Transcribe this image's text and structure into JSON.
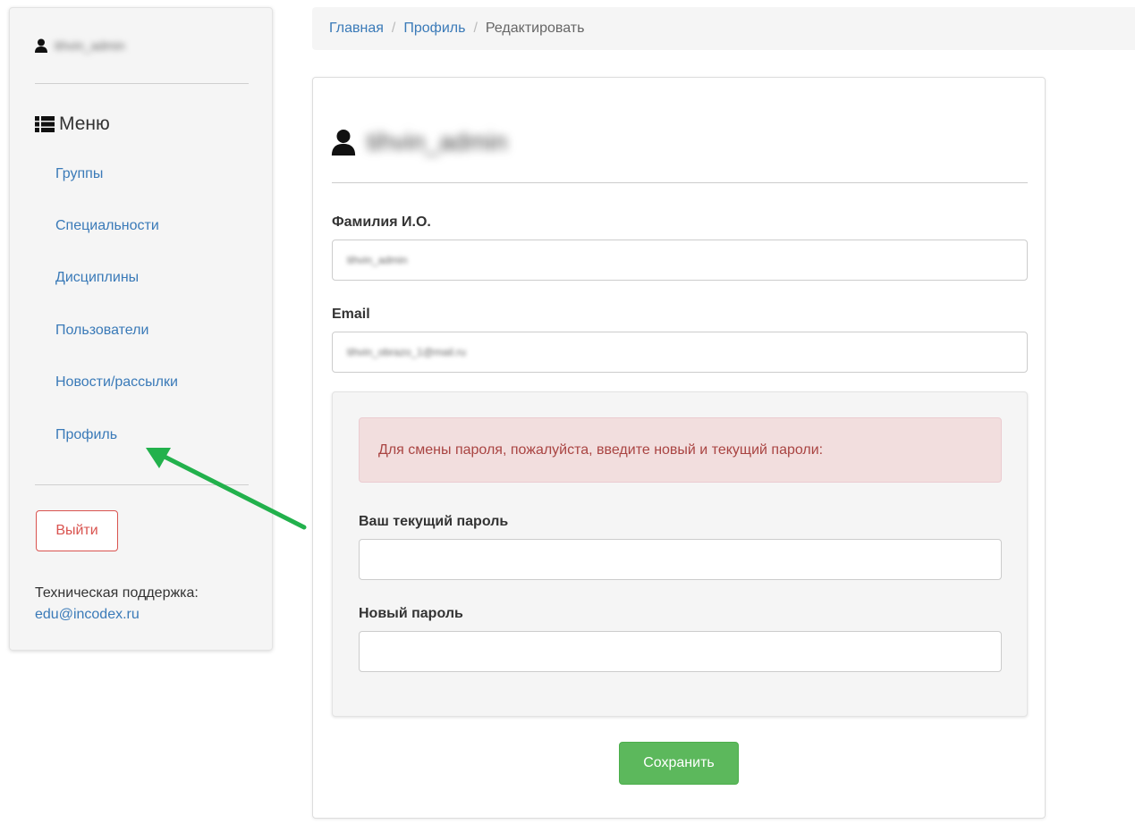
{
  "sidebar": {
    "user_name": "tihvin_admin",
    "menu_title": "Меню",
    "items": [
      {
        "label": "Группы"
      },
      {
        "label": "Специальности"
      },
      {
        "label": "Дисциплины"
      },
      {
        "label": "Пользователи"
      },
      {
        "label": "Новости/рассылки"
      },
      {
        "label": "Профиль"
      }
    ],
    "logout_label": "Выйти",
    "support_label": "Техническая поддержка:",
    "support_email": "edu@incodex.ru"
  },
  "breadcrumb": {
    "items": [
      "Главная",
      "Профиль"
    ],
    "separator": "/",
    "active": "Редактировать"
  },
  "profile": {
    "username": "tihvin_admin",
    "fio_label": "Фамилия И.О.",
    "fio_value": "tihvin_admin",
    "email_label": "Email",
    "email_value": "tihvin_obrazo_1@mail.ru",
    "password_alert": "Для смены пароля, пожалуйста, введите новый и текущий пароли:",
    "current_password_label": "Ваш текущий пароль",
    "current_password_value": "",
    "new_password_label": "Новый пароль",
    "new_password_value": "",
    "save_label": "Сохранить"
  },
  "colors": {
    "link": "#3a7ab8",
    "danger": "#d9534f",
    "success": "#5cb85c",
    "alert_bg": "#f2dede",
    "alert_text": "#a94442",
    "annotation_arrow": "#22b14c"
  },
  "icons": {
    "user": "user-icon",
    "menu": "list-icon",
    "annotation": "green-arrow"
  }
}
